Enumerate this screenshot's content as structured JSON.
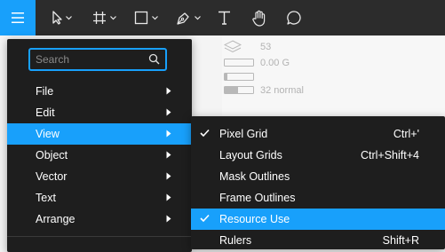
{
  "toolbar": {
    "tools": [
      {
        "name": "menu-icon"
      },
      {
        "name": "move-tool-icon"
      },
      {
        "name": "frame-tool-icon"
      },
      {
        "name": "rectangle-tool-icon"
      },
      {
        "name": "pen-tool-icon"
      },
      {
        "name": "text-tool-icon"
      },
      {
        "name": "hand-tool-icon"
      },
      {
        "name": "comment-tool-icon"
      }
    ],
    "accent": "#18a0fb"
  },
  "properties": {
    "layer_value": "53",
    "effect_value": "0.00 G",
    "blend_value": "32 normal"
  },
  "main_menu": {
    "search_placeholder": "Search",
    "items": [
      {
        "label": "File"
      },
      {
        "label": "Edit"
      },
      {
        "label": "View"
      },
      {
        "label": "Object"
      },
      {
        "label": "Vector"
      },
      {
        "label": "Text"
      },
      {
        "label": "Arrange"
      }
    ],
    "highlighted": "View"
  },
  "view_submenu": {
    "items": [
      {
        "label": "Pixel Grid",
        "shortcut": "Ctrl+'",
        "checked": true
      },
      {
        "label": "Layout Grids",
        "shortcut": "Ctrl+Shift+4",
        "checked": false
      },
      {
        "label": "Mask Outlines",
        "shortcut": "",
        "checked": false
      },
      {
        "label": "Frame Outlines",
        "shortcut": "",
        "checked": false
      },
      {
        "label": "Resource Use",
        "shortcut": "",
        "checked": true
      },
      {
        "label": "Rulers",
        "shortcut": "Shift+R",
        "checked": false
      }
    ],
    "highlighted": "Resource Use"
  }
}
